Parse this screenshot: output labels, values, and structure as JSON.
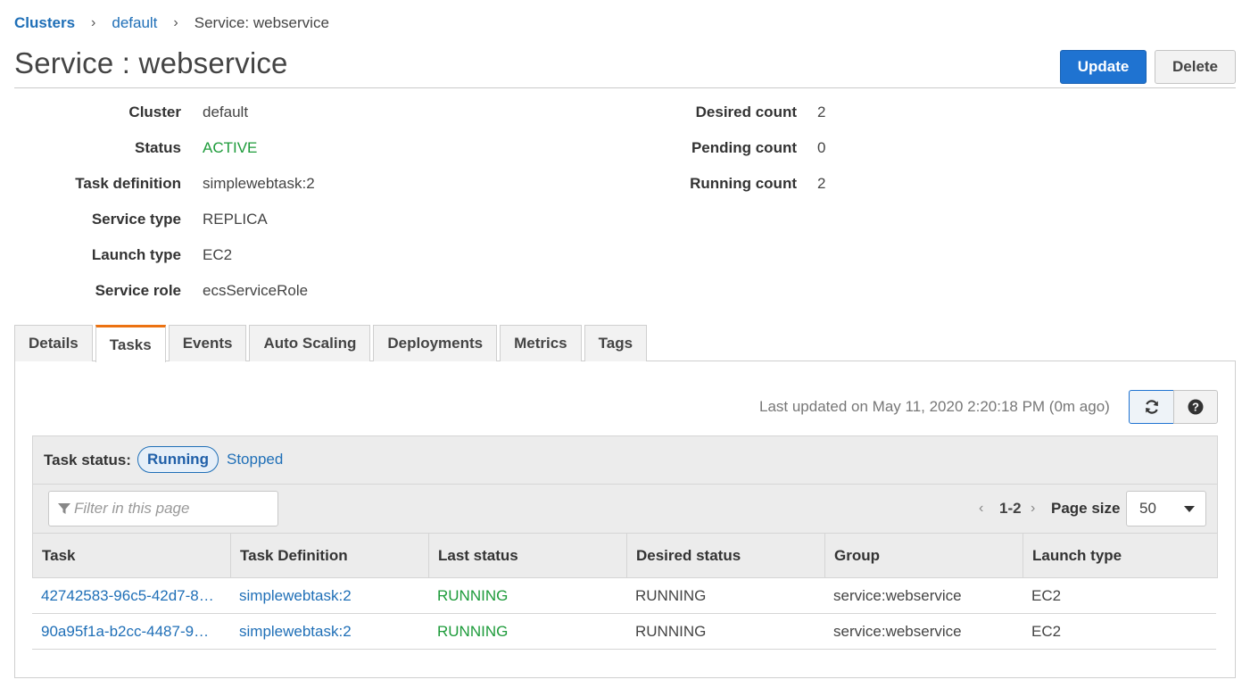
{
  "breadcrumb": {
    "root": "Clusters",
    "cluster": "default",
    "current": "Service: webservice"
  },
  "page": {
    "title": "Service : webservice",
    "update_label": "Update",
    "delete_label": "Delete"
  },
  "summary": {
    "left": [
      {
        "label": "Cluster",
        "value": "default"
      },
      {
        "label": "Status",
        "value": "ACTIVE"
      },
      {
        "label": "Task definition",
        "value": "simplewebtask:2"
      },
      {
        "label": "Service type",
        "value": "REPLICA"
      },
      {
        "label": "Launch type",
        "value": "EC2"
      },
      {
        "label": "Service role",
        "value": "ecsServiceRole"
      }
    ],
    "right": [
      {
        "label": "Desired count",
        "value": "2"
      },
      {
        "label": "Pending count",
        "value": "0"
      },
      {
        "label": "Running count",
        "value": "2"
      }
    ]
  },
  "tabs": [
    {
      "label": "Details"
    },
    {
      "label": "Tasks",
      "active": true
    },
    {
      "label": "Events"
    },
    {
      "label": "Auto Scaling"
    },
    {
      "label": "Deployments"
    },
    {
      "label": "Metrics"
    },
    {
      "label": "Tags"
    }
  ],
  "tasks_panel": {
    "last_updated": "Last updated on May 11, 2020 2:20:18 PM (0m ago)",
    "refresh_icon": "refresh-icon",
    "help_icon": "help-icon",
    "task_status_label": "Task status:",
    "status_running": "Running",
    "status_stopped": "Stopped",
    "filter_placeholder": "Filter in this page",
    "pager_range": "1-2",
    "page_size_label": "Page size",
    "page_size_value": "50",
    "columns": [
      "Task",
      "Task Definition",
      "Last status",
      "Desired status",
      "Group",
      "Launch type"
    ],
    "rows": [
      {
        "task": "42742583-96c5-42d7-8…",
        "task_definition": "simplewebtask:2",
        "last_status": "RUNNING",
        "desired_status": "RUNNING",
        "group": "service:webservice",
        "launch_type": "EC2"
      },
      {
        "task": "90a95f1a-b2cc-4487-9…",
        "task_definition": "simplewebtask:2",
        "last_status": "RUNNING",
        "desired_status": "RUNNING",
        "group": "service:webservice",
        "launch_type": "EC2"
      }
    ]
  },
  "colors": {
    "link": "#1f6fb7",
    "active_status": "#1d9b3a",
    "primary_button": "#1f73d1",
    "active_tab_accent": "#ec7211"
  }
}
